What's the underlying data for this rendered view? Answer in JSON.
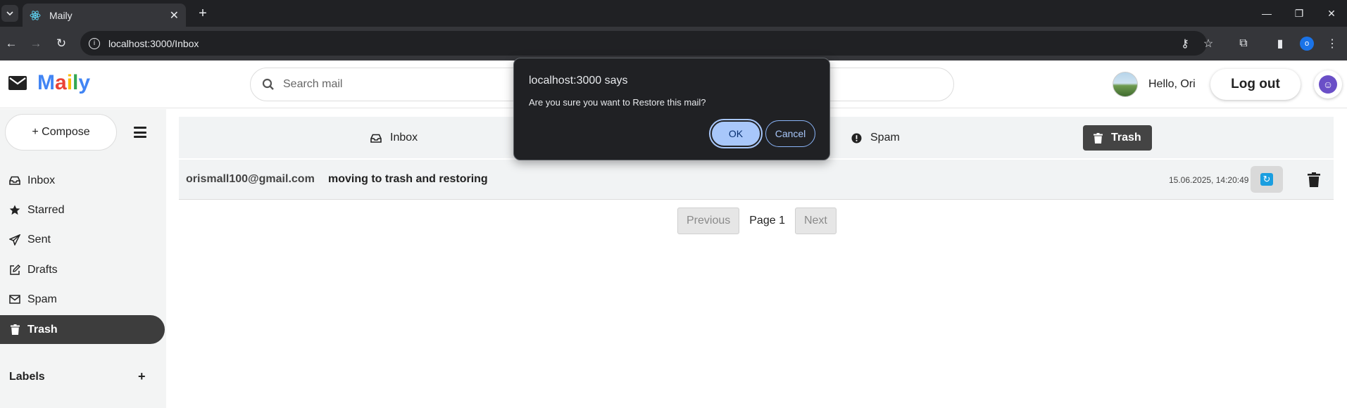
{
  "browser": {
    "tab_title": "Maily",
    "url": "localhost:3000/Inbox",
    "profile_initial": "o"
  },
  "header": {
    "logo_letters": [
      "M",
      "a",
      "i",
      "l",
      "y"
    ],
    "search_placeholder": "Search mail",
    "greeting": "Hello, Ori",
    "logout_label": "Log out"
  },
  "sidebar": {
    "compose_label": "+ Compose",
    "items": [
      {
        "label": "Inbox",
        "icon": "inbox-icon"
      },
      {
        "label": "Starred",
        "icon": "star-icon"
      },
      {
        "label": "Sent",
        "icon": "send-icon"
      },
      {
        "label": "Drafts",
        "icon": "edit-icon"
      },
      {
        "label": "Spam",
        "icon": "envelope-icon"
      },
      {
        "label": "Trash",
        "icon": "trash-icon",
        "active": true
      }
    ],
    "labels_title": "Labels",
    "labels_add": "+"
  },
  "folder_tabs": [
    {
      "label": "Inbox",
      "icon": "inbox-icon"
    },
    {
      "label": "Spam",
      "icon": "exclamation-icon"
    },
    {
      "label": "Trash",
      "icon": "trash-icon",
      "active": true
    }
  ],
  "mail_rows": [
    {
      "sender": "orismall100@gmail.com",
      "subject": "moving to trash and restoring",
      "date": "15.06.2025, 14:20:49"
    }
  ],
  "pagination": {
    "previous_label": "Previous",
    "page_label": "Page 1",
    "next_label": "Next"
  },
  "dialog": {
    "title": "localhost:3000 says",
    "message": "Are you sure you want to Restore this mail?",
    "ok_label": "OK",
    "cancel_label": "Cancel"
  },
  "colors": {
    "active_nav_bg": "#3d3d3d",
    "restore_accent": "#1a9ee0",
    "dialog_ok": "#a8c7fa"
  }
}
